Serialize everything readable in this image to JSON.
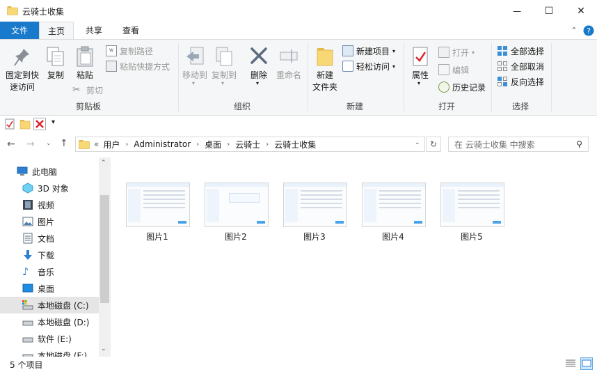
{
  "window": {
    "title": "云骑士收集"
  },
  "controls": {
    "minimize": "—",
    "maximize": "☐",
    "close": "✕"
  },
  "tabs": [
    {
      "label": "文件"
    },
    {
      "label": "主页"
    },
    {
      "label": "共享"
    },
    {
      "label": "查看"
    }
  ],
  "ribbon": {
    "clipboard": {
      "group_label": "剪贴板",
      "pin_label": [
        "固定到快",
        "速访问"
      ],
      "copy": "复制",
      "paste": "粘贴",
      "copy_path": "复制路径",
      "paste_shortcut": "粘贴快捷方式",
      "cut": "剪切"
    },
    "organize": {
      "group_label": "组织",
      "move_to": "移动到",
      "copy_to": "复制到",
      "delete": "删除",
      "rename": "重命名"
    },
    "new": {
      "group_label": "新建",
      "new_folder": [
        "新建",
        "文件夹"
      ],
      "new_item": "新建项目",
      "easy_access": "轻松访问"
    },
    "open": {
      "group_label": "打开",
      "properties": "属性",
      "open": "打开",
      "edit": "编辑",
      "history": "历史记录"
    },
    "select": {
      "group_label": "选择",
      "select_all": "全部选择",
      "select_none": "全部取消",
      "invert": "反向选择"
    }
  },
  "address": {
    "prefix": "«",
    "crumbs": [
      "用户",
      "Administrator",
      "桌面",
      "云骑士",
      "云骑士收集"
    ],
    "search_placeholder": "在 云骑士收集 中搜索"
  },
  "nav_pane": [
    {
      "label": "此电脑",
      "icon": "computer-icon"
    },
    {
      "label": "3D 对象",
      "icon": "3d-objects-icon"
    },
    {
      "label": "视频",
      "icon": "video-icon"
    },
    {
      "label": "图片",
      "icon": "pictures-icon"
    },
    {
      "label": "文档",
      "icon": "documents-icon"
    },
    {
      "label": "下载",
      "icon": "downloads-icon"
    },
    {
      "label": "音乐",
      "icon": "music-icon"
    },
    {
      "label": "桌面",
      "icon": "desktop-icon"
    },
    {
      "label": "本地磁盘 (C:)",
      "icon": "drive-c-icon",
      "selected": true
    },
    {
      "label": "本地磁盘 (D:)",
      "icon": "drive-icon"
    },
    {
      "label": "软件 (E:)",
      "icon": "drive-icon"
    },
    {
      "label": "本地磁盘 (F:)",
      "icon": "drive-icon"
    }
  ],
  "files": [
    {
      "name": "图片1"
    },
    {
      "name": "图片2"
    },
    {
      "name": "图片3"
    },
    {
      "name": "图片4"
    },
    {
      "name": "图片5"
    }
  ],
  "status": {
    "count": "5 个项目"
  },
  "colors": {
    "accent": "#1979ca",
    "folder": "#f8d775",
    "delete": "#d9262c"
  }
}
